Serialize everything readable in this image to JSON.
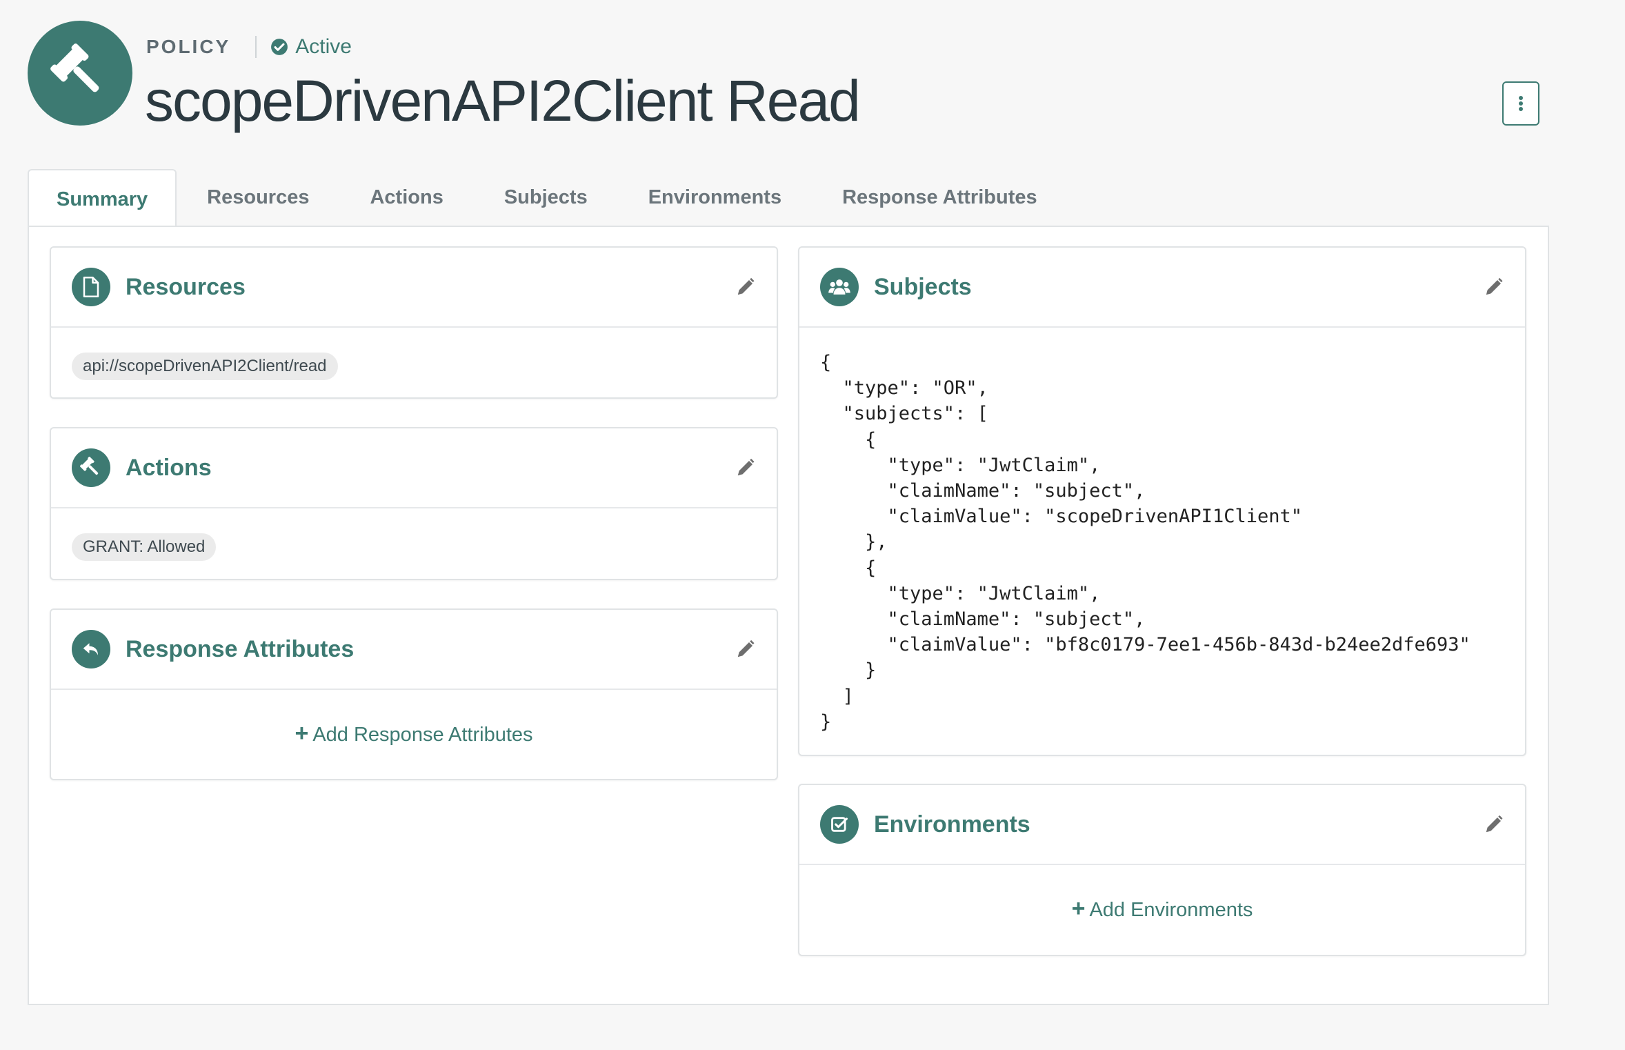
{
  "header": {
    "kind": "POLICY",
    "status": "Active",
    "title": "scopeDrivenAPI2Client Read",
    "hero_icon": "gavel-icon",
    "menu_icon": "kebab-vertical-icon"
  },
  "tabs": [
    {
      "label": "Summary",
      "active": true
    },
    {
      "label": "Resources"
    },
    {
      "label": "Actions"
    },
    {
      "label": "Subjects"
    },
    {
      "label": "Environments"
    },
    {
      "label": "Response Attributes"
    }
  ],
  "cards": {
    "resources": {
      "title": "Resources",
      "icon": "file-icon",
      "chip": "api://scopeDrivenAPI2Client/read"
    },
    "actions": {
      "title": "Actions",
      "icon": "gavel-icon",
      "chip": "GRANT: Allowed"
    },
    "response_attributes": {
      "title": "Response Attributes",
      "icon": "reply-icon",
      "add_label": "Add Response Attributes"
    },
    "subjects": {
      "title": "Subjects",
      "icon": "users-icon",
      "code": "{\n  \"type\": \"OR\",\n  \"subjects\": [\n    {\n      \"type\": \"JwtClaim\",\n      \"claimName\": \"subject\",\n      \"claimValue\": \"scopeDrivenAPI1Client\"\n    },\n    {\n      \"type\": \"JwtClaim\",\n      \"claimName\": \"subject\",\n      \"claimValue\": \"bf8c0179-7ee1-456b-843d-b24ee2dfe693\"\n    }\n  ]\n}"
    },
    "environments": {
      "title": "Environments",
      "icon": "check-square-icon",
      "add_label": "Add Environments"
    }
  },
  "colors": {
    "accent": "#3d7a72",
    "background": "#f7f7f7",
    "title": "#2b3940"
  }
}
